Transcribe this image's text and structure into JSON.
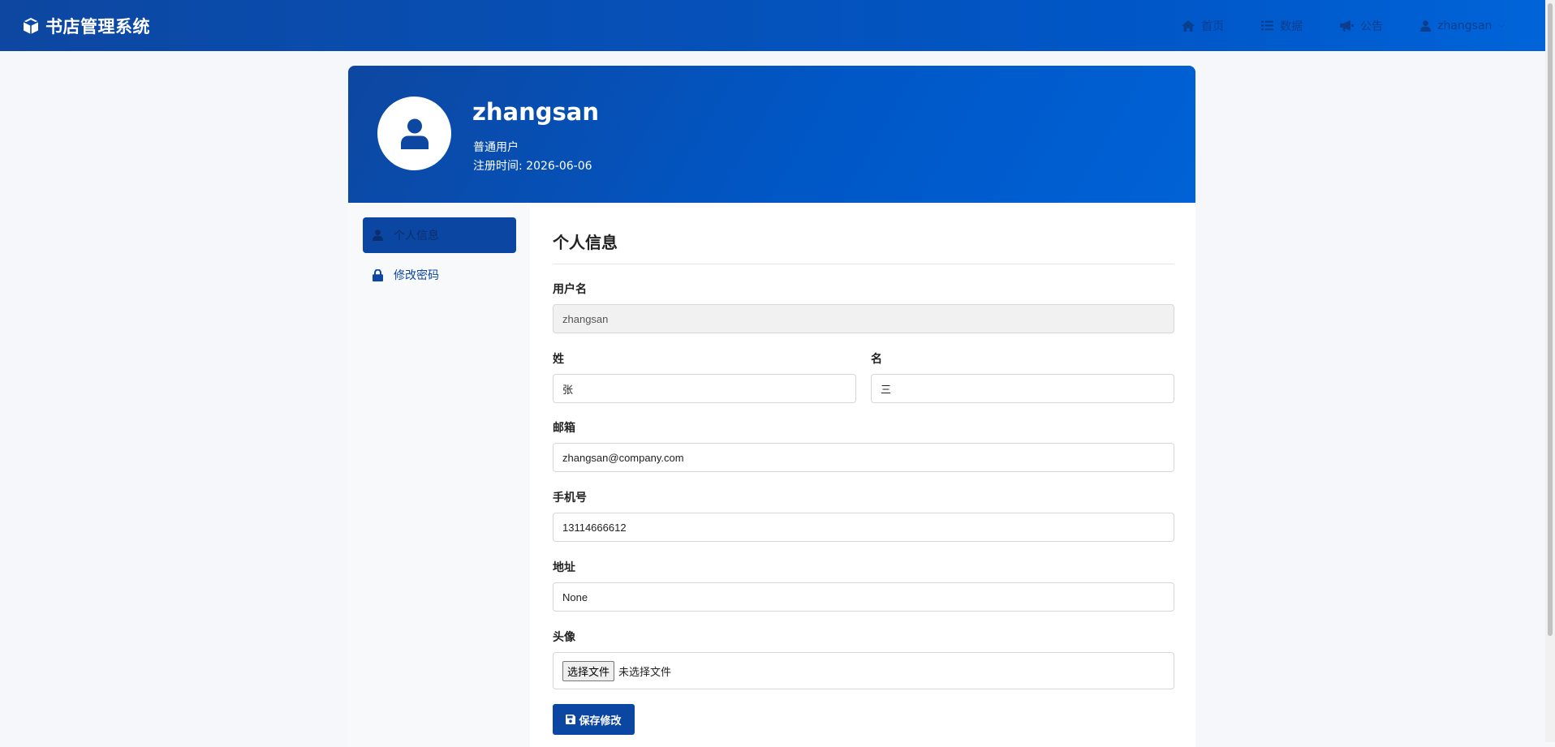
{
  "navbar": {
    "brand": "书店管理系统",
    "links": [
      {
        "label": "首页",
        "icon": "home-icon"
      },
      {
        "label": "数据",
        "icon": "list-icon"
      },
      {
        "label": "公告",
        "icon": "megaphone-icon"
      }
    ],
    "user": {
      "label": "zhangsan",
      "icon": "user-icon"
    }
  },
  "profile": {
    "name": "zhangsan",
    "role": "普通用户",
    "registered_label": "注册时间:",
    "registered_date": "2026-06-06"
  },
  "sidebar": {
    "items": [
      {
        "label": "个人信息",
        "icon": "user-icon",
        "active": true
      },
      {
        "label": "修改密码",
        "icon": "lock-icon",
        "active": false
      }
    ]
  },
  "form": {
    "title": "个人信息",
    "username": {
      "label": "用户名",
      "value": "zhangsan"
    },
    "last_name": {
      "label": "姓",
      "value": "张"
    },
    "first_name": {
      "label": "名",
      "value": "三"
    },
    "email": {
      "label": "邮箱",
      "value": "zhangsan@company.com"
    },
    "phone": {
      "label": "手机号",
      "value": "13114666612"
    },
    "address": {
      "label": "地址",
      "value": "None"
    },
    "avatar": {
      "label": "头像",
      "button": "选择文件",
      "status": "未选择文件"
    },
    "save_label": "保存修改"
  },
  "colors": {
    "primary": "#0d47a1",
    "primary_light": "#0064d8",
    "page_bg": "#f5f7fa"
  }
}
